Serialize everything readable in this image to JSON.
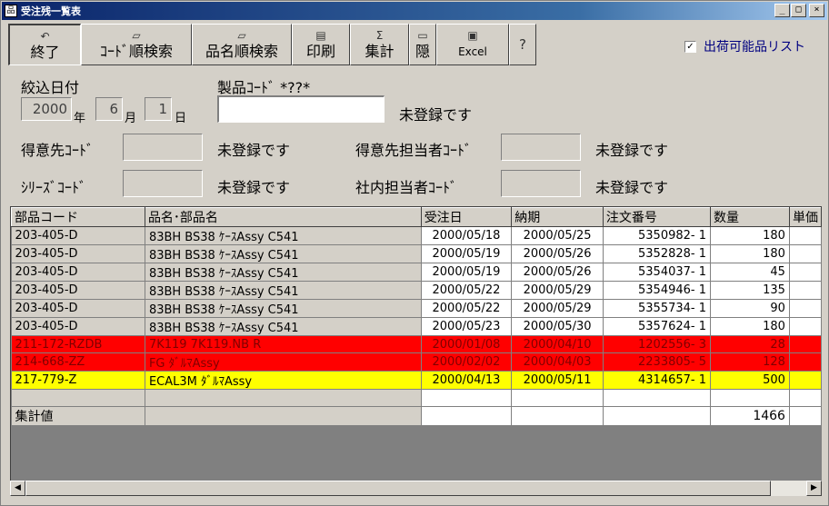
{
  "window": {
    "title": "受注残一覧表",
    "controls": [
      "_",
      "□",
      "×"
    ]
  },
  "toolbar": {
    "exit_label": "終了",
    "code_search_label": "ｺｰﾄﾞ順検索",
    "name_search_label": "品名順検索",
    "print_label": "印刷",
    "sum_label": "集計",
    "hide_label": "隠",
    "excel_label": "Excel",
    "sum_icon": "Σ"
  },
  "shippable_only": {
    "label": "出荷可能品リスト",
    "checked": "✓"
  },
  "filter": {
    "date_label": "絞込日付",
    "year_value": "2000",
    "year_unit": "年",
    "month_value": "6",
    "month_unit": "月",
    "day_value": "1",
    "day_unit": "日",
    "product_code_label": "製品ｺｰﾄﾞ *??*",
    "product_status": "未登録です",
    "customer_code_label": "得意先ｺｰﾄﾞ",
    "customer_status": "未登録です",
    "customer_rep_label": "得意先担当者ｺｰﾄﾞ",
    "customer_rep_status": "未登録です",
    "series_code_label": "ｼﾘｰｽﾞｺｰﾄﾞ",
    "series_status": "未登録です",
    "internal_rep_label": "社内担当者ｺｰﾄﾞ",
    "internal_rep_status": "未登録です"
  },
  "grid": {
    "headers": [
      "部品コード",
      "品名･部品名",
      "受注日",
      "納期",
      "注文番号",
      "数量",
      "単価"
    ],
    "rows": [
      {
        "code": "203-405-D",
        "name": "83BH BS38 ｹｰｽAssy C541",
        "order_date": "2000/05/18",
        "due_date": "2000/05/25",
        "order_no": "5350982- 1",
        "qty": "180",
        "style": "normal"
      },
      {
        "code": "203-405-D",
        "name": "83BH BS38 ｹｰｽAssy C541",
        "order_date": "2000/05/19",
        "due_date": "2000/05/26",
        "order_no": "5352828- 1",
        "qty": "180",
        "style": "normal"
      },
      {
        "code": "203-405-D",
        "name": "83BH BS38 ｹｰｽAssy C541",
        "order_date": "2000/05/19",
        "due_date": "2000/05/26",
        "order_no": "5354037- 1",
        "qty": "45",
        "style": "normal"
      },
      {
        "code": "203-405-D",
        "name": "83BH BS38 ｹｰｽAssy C541",
        "order_date": "2000/05/22",
        "due_date": "2000/05/29",
        "order_no": "5354946- 1",
        "qty": "135",
        "style": "normal"
      },
      {
        "code": "203-405-D",
        "name": "83BH BS38 ｹｰｽAssy C541",
        "order_date": "2000/05/22",
        "due_date": "2000/05/29",
        "order_no": "5355734- 1",
        "qty": "90",
        "style": "normal"
      },
      {
        "code": "203-405-D",
        "name": "83BH BS38 ｹｰｽAssy C541",
        "order_date": "2000/05/23",
        "due_date": "2000/05/30",
        "order_no": "5357624- 1",
        "qty": "180",
        "style": "normal"
      },
      {
        "code": "211-172-RZDB",
        "name": "7K119 7K119.NB R",
        "order_date": "2000/01/08",
        "due_date": "2000/04/10",
        "order_no": "1202556- 3",
        "qty": "28",
        "style": "red"
      },
      {
        "code": "214-668-ZZ",
        "name": "FG ﾀﾞﾙﾏAssy",
        "order_date": "2000/02/02",
        "due_date": "2000/04/03",
        "order_no": "2233805- 5",
        "qty": "128",
        "style": "red"
      },
      {
        "code": "217-779-Z",
        "name": "ECAL3M ﾀﾞﾙﾏAssy",
        "order_date": "2000/04/13",
        "due_date": "2000/05/11",
        "order_no": "4314657- 1",
        "qty": "500",
        "style": "yellow"
      }
    ],
    "total_label": "集計値",
    "total_qty": "1466"
  },
  "scrollbar": {
    "left_arrow": "◀",
    "right_arrow": "▶"
  }
}
